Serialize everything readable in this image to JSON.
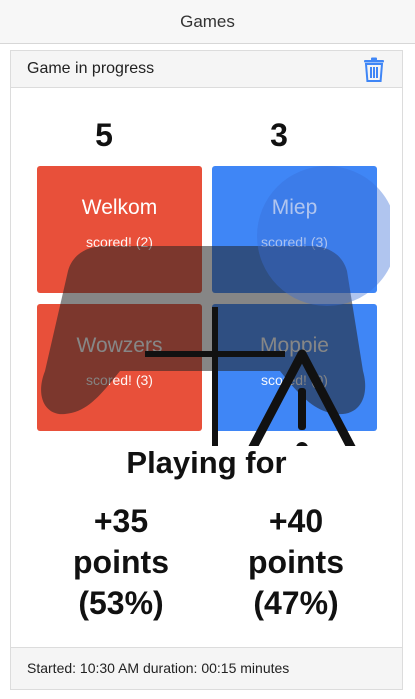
{
  "app": {
    "title": "Games"
  },
  "card": {
    "header": "Game in progress",
    "trash_icon": "trash-icon"
  },
  "scores": {
    "left": "5",
    "right": "3"
  },
  "tiles": [
    {
      "name": "Welkom",
      "status": "scored! (2)",
      "color": "#e8503a"
    },
    {
      "name": "Miep",
      "status": "scored! (3)",
      "color": "#3f86f6"
    },
    {
      "name": "Wowzers",
      "status": "scored! (3)",
      "color": "#e8503a"
    },
    {
      "name": "Moppie",
      "status": "scored! (0)",
      "color": "#3f86f6"
    }
  ],
  "playing": {
    "title": "Playing for",
    "left": {
      "points": "+35",
      "unit": "points",
      "percent": "(53%)"
    },
    "right": {
      "points": "+40",
      "unit": "points",
      "percent": "(47%)"
    }
  },
  "footer": {
    "text": "Started: 10:30 AM duration: 00:15 minutes"
  },
  "icons": [
    "trash-icon",
    "warning-icon",
    "plus-icon"
  ]
}
